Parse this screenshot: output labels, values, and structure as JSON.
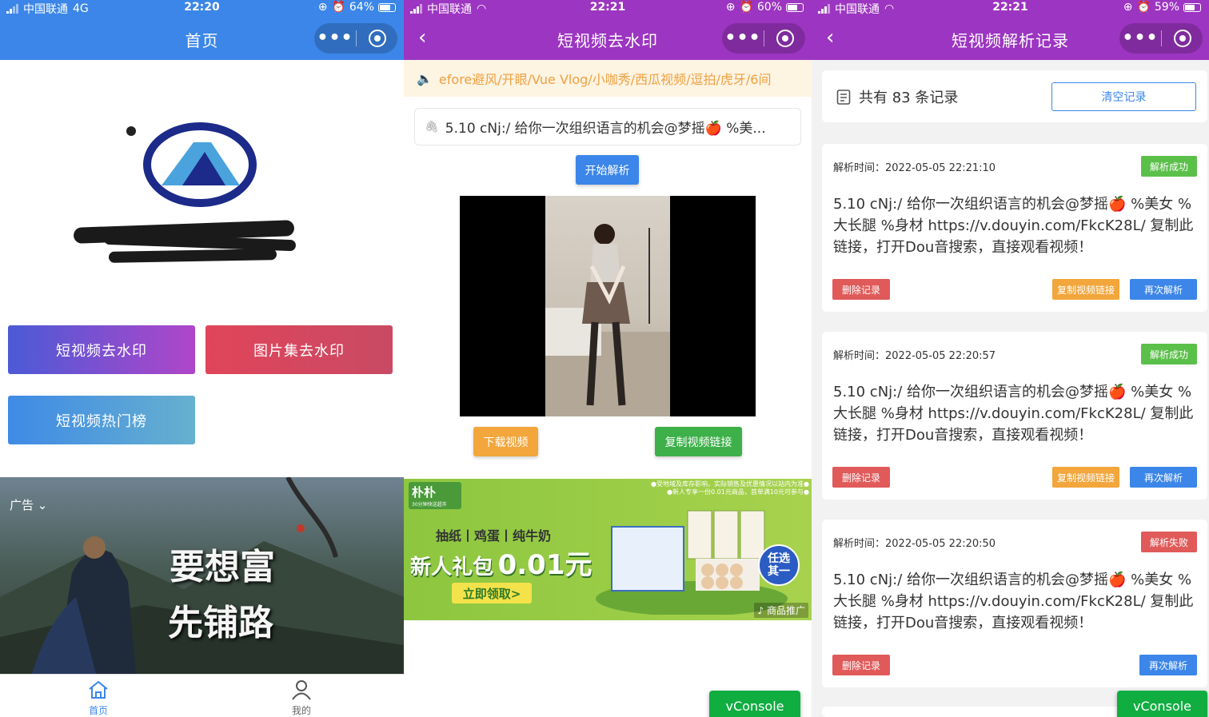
{
  "screen1": {
    "status": {
      "carrier": "中国联通",
      "network": "4G",
      "time": "22:20",
      "battery": "64%"
    },
    "nav": {
      "title": "首页"
    },
    "buttons": {
      "video": "短视频去水印",
      "image": "图片集去水印",
      "hot": "短视频热门榜"
    },
    "ad": {
      "label": "广告",
      "slogan_line1": "要想富",
      "slogan_line2": "先铺路"
    },
    "tabs": [
      {
        "label": "首页",
        "icon": "home-icon",
        "active": true
      },
      {
        "label": "我的",
        "icon": "user-icon",
        "active": false
      }
    ],
    "colors": {
      "nav": "#3b86e8",
      "tab_active": "#3b86e8"
    }
  },
  "screen2": {
    "status": {
      "carrier": "中国联通",
      "time": "22:21",
      "battery": "60%"
    },
    "nav": {
      "title": "短视频去水印"
    },
    "notice": "efore避风/开眼/Vue Vlog/小咖秀/西瓜视频/逗拍/虎牙/6间",
    "input_value": "5.10 cNj:/ 给你一次组织语言的机会@梦摇🍎 %美...",
    "buttons": {
      "parse": "开始解析",
      "download": "下载视频",
      "copy_link": "复制视频链接"
    },
    "ad": {
      "brand": "朴朴",
      "brand_sub": "30分钟快送超市",
      "products": "抽纸丨鸡蛋丨纯牛奶",
      "headline": "新人礼包",
      "price": "0.01元",
      "cta": "立即领取>",
      "choose": "任选其一",
      "note": "●受地域及库存影响，实际销售及优惠情况以站内为准●",
      "note2": "●新人专享一份0.01元商品，首单满10元可参与●",
      "tag": "商品推广"
    },
    "vconsole": "vConsole",
    "colors": {
      "nav": "#9c35c1"
    }
  },
  "screen3": {
    "status": {
      "carrier": "中国联通",
      "time": "22:21",
      "battery": "59%"
    },
    "nav": {
      "title": "短视频解析记录"
    },
    "count_text": "共有 83 条记录",
    "clear_label": "清空记录",
    "records": [
      {
        "time": "解析时间：2022-05-05 22:21:10",
        "status": "解析成功",
        "status_color": "#5bc04a",
        "content": "5.10 cNj:/ 给你一次组织语言的机会@梦摇🍎 %美女 %大长腿 %身材 https://v.douyin.com/FkcK28L/ 复制此链接，打开Dou音搜索，直接观看视频！",
        "delete": "删除记录",
        "copy": "复制视频链接",
        "reparse": "再次解析"
      },
      {
        "time": "解析时间：2022-05-05 22:20:57",
        "status": "解析成功",
        "status_color": "#5bc04a",
        "content": "5.10 cNj:/ 给你一次组织语言的机会@梦摇🍎 %美女 %大长腿 %身材 https://v.douyin.com/FkcK28L/ 复制此链接，打开Dou音搜索，直接观看视频！",
        "delete": "删除记录",
        "copy": "复制视频链接",
        "reparse": "再次解析"
      },
      {
        "time": "解析时间：2022-05-05 22:20:50",
        "status": "解析失败",
        "status_color": "#e05a5a",
        "content": "5.10 cNj:/ 给你一次组织语言的机会@梦摇🍎 %美女 %大长腿 %身材 https://v.douyin.com/FkcK28L/ 复制此链接，打开Dou音搜索，直接观看视频！",
        "delete": "删除记录",
        "reparse": "再次解析"
      }
    ],
    "vconsole": "vConsole",
    "colors": {
      "nav": "#9c35c1",
      "delete": "#e05a5a",
      "copy": "#f2a63b",
      "reparse": "#3b86e8"
    }
  }
}
